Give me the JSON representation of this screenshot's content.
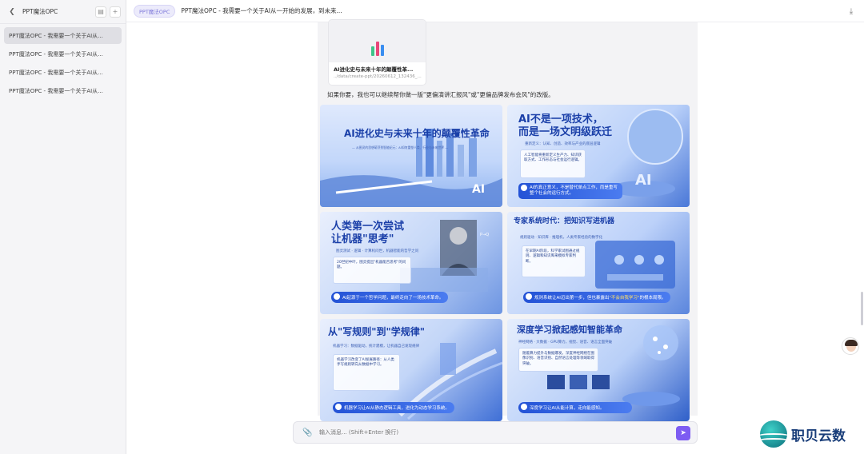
{
  "sidebar": {
    "title": "PPT魔法OPC",
    "items": [
      {
        "label": "PPT魔法OPC - 我需要一个关于AI从..."
      },
      {
        "label": "PPT魔法OPC - 我需要一个关于AI从..."
      },
      {
        "label": "PPT魔法OPC - 我需要一个关于AI从..."
      },
      {
        "label": "PPT魔法OPC - 我需要一个关于AI从..."
      }
    ]
  },
  "header": {
    "tag": "PPT魔法OPC",
    "title": "PPT魔法OPC - 我需要一个关于AI从一开始的发展，到未来..."
  },
  "file": {
    "name": "AI进化史与未来十年的颠覆性革...",
    "path": "../data/create-ppt/20260612_132436_..."
  },
  "message": "如果你要，我也可以继续帮你做一版\"更偏演讲汇报风\"或\"更偏品牌发布会风\"的改版。",
  "slides": [
    {
      "title": "AI进化史与未来十年的颠覆性革命",
      "subtitle": "— 从图灵的思想萌芽到智能纪元：AI如何重塑人类、行业与未来世界 —"
    },
    {
      "title_line1": "AI不是一项技术，",
      "title_line2": "而是一场文明级跃迁",
      "subtitle": "重新定义：认知、创造、效率与产业的底层逻辑",
      "box": "人工智能将重新定义生产力、知识获取方式、工作形态与社会运行逻辑。",
      "pill": "AI的真正意义，不是替代单点工作，而是重写整个社会的运行方式。"
    },
    {
      "title_line1": "人类第一次尝试",
      "title_line2": "让机器\"思考\"",
      "subtitle": "图灵测试 · 逻辑 · 计算机问世，机器智能的哲学之问",
      "box": "20世纪中叶，图灵提出\"机器能否思考\"的问题。",
      "pill": "AI起源于一个哲学问题，最终走向了一场技术革命。"
    },
    {
      "title": "专家系统时代：把知识写进机器",
      "subtitle": "规则驱动 · 知识库 · 推理机，人类专家经验的数字化",
      "box": "在早期AI阶段，科学家试图通过规则、逻辑和知识库来模拟专家判断。",
      "pill_pre": "规则系统让AI迈出第一步，但也暴露出",
      "pill_hl": "\"不会自我学习\"",
      "pill_post": "的根本局限。"
    },
    {
      "title": "从\"写规则\"到\"学规律\"",
      "subtitle": "机器学习：数据驱动，统计建模，让机器自己发现规律",
      "box": "机器学习改变了AI发展路径：从人类手写规则转向从数据中学习。",
      "pill": "机器学习让AI从静态逻辑工具，进化为动态学习系统。"
    },
    {
      "title": "深度学习掀起感知智能革命",
      "subtitle": "神经网络 · 大数据 · GPU算力，视觉、语音、语言全面突破",
      "box": "随着算力提升与数据爆发，深度神经网络在图像识别、语音识别、自然语言处理等领域取得突破。",
      "pill": "深度学习让AI从能计算，走向能感知。"
    }
  ],
  "input": {
    "placeholder": "输入消息... (Shift+Enter 换行)"
  },
  "watermark": {
    "text": "职贝云数"
  }
}
